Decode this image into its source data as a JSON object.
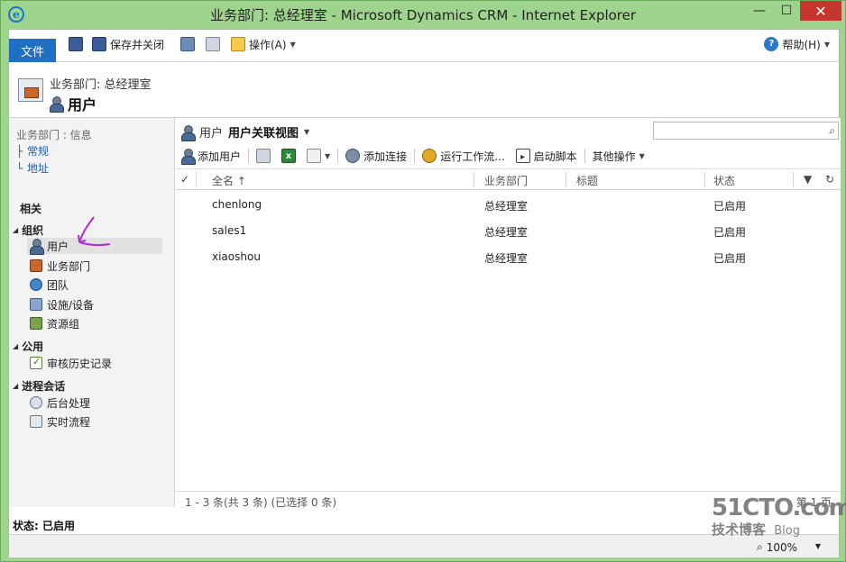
{
  "window": {
    "title": "业务部门: 总经理室 - Microsoft Dynamics CRM - Internet Explorer",
    "minimize": "—",
    "maximize": "☐",
    "close": "✕"
  },
  "ribbon": {
    "file_tab": "文件",
    "save_close": "保存并关闭",
    "actions": "操作(A)",
    "help": "帮助(H)"
  },
  "header": {
    "subtitle": "业务部门: 总经理室",
    "title": "用户"
  },
  "leftnav": {
    "info_title": "业务部门 : 信息",
    "info_links": [
      "常规",
      "地址"
    ],
    "related": "相关",
    "groups": [
      {
        "title": "组织",
        "items": [
          "用户",
          "业务部门",
          "团队",
          "设施/设备",
          "资源组"
        ]
      },
      {
        "title": "公用",
        "items": [
          "审核历史记录"
        ]
      },
      {
        "title": "进程会话",
        "items": [
          "后台处理",
          "实时流程"
        ]
      }
    ],
    "selected_item": "用户"
  },
  "main": {
    "entity_label": "用户",
    "view_name": "用户关联视图",
    "search_placeholder": "",
    "commands": {
      "add_user": "添加用户",
      "add_connection": "添加连接",
      "run_workflow": "运行工作流...",
      "start_dialog": "启动脚本",
      "more_actions": "其他操作"
    },
    "columns": [
      "全名 ↑",
      "业务部门",
      "标题",
      "状态"
    ],
    "rows": [
      [
        "chenlong",
        "总经理室",
        "",
        "已启用"
      ],
      [
        "sales1",
        "总经理室",
        "",
        "已启用"
      ],
      [
        "xiaoshou",
        "总经理室",
        "",
        "已启用"
      ]
    ],
    "pager": "1 - 3  条(共 3 条) (已选择 0 条)",
    "page_label": "第 1 页"
  },
  "status": {
    "label": "状态: 已启用",
    "zoom": "100%"
  },
  "watermark": {
    "top": "51CTO.com",
    "bottom": "技术博客",
    "blog": "Blog"
  },
  "colors": {
    "window_frame": "#9fd48e",
    "file_tab": "#1f6fc5",
    "close_button": "#c7352f",
    "link": "#1a5fb0"
  }
}
